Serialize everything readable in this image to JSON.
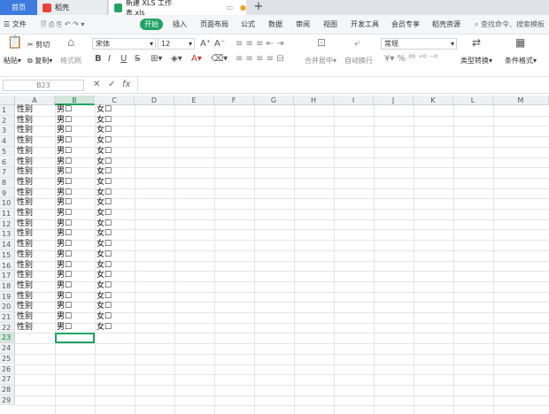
{
  "tabs": {
    "home": "首页",
    "shell": "稻壳",
    "file": "新建 XLS 工作表.xls"
  },
  "menu": {
    "file": "文件",
    "start": "开始",
    "items": [
      "插入",
      "页面布局",
      "公式",
      "数据",
      "审阅",
      "视图",
      "开发工具",
      "会员专享",
      "稻壳资源"
    ],
    "search": "查找命令、搜索模板"
  },
  "ribbon": {
    "paste": "粘贴",
    "cut": "剪切",
    "copy": "复制",
    "format_painter": "格式刷",
    "font_name": "宋体",
    "font_size": "12",
    "merge_center": "合并居中",
    "wrap_text": "自动换行",
    "number_format": "常规",
    "type_convert": "类型转换",
    "cond_format": "条件格式"
  },
  "formula_bar": {
    "name_box": "B23",
    "fx": "fx",
    "content": ""
  },
  "sheet": {
    "columns": [
      "A",
      "B",
      "C",
      "D",
      "E",
      "F",
      "G",
      "H",
      "I",
      "J",
      "K",
      "L",
      "M"
    ],
    "selected_column": "B",
    "selected_row": 23,
    "row_count": 29,
    "col_a": "性别",
    "col_b": "男☐",
    "col_c": "女☐",
    "data_rows": 22
  },
  "colors": {
    "accent": "#1fa463",
    "home_tab": "#3d7be0"
  }
}
